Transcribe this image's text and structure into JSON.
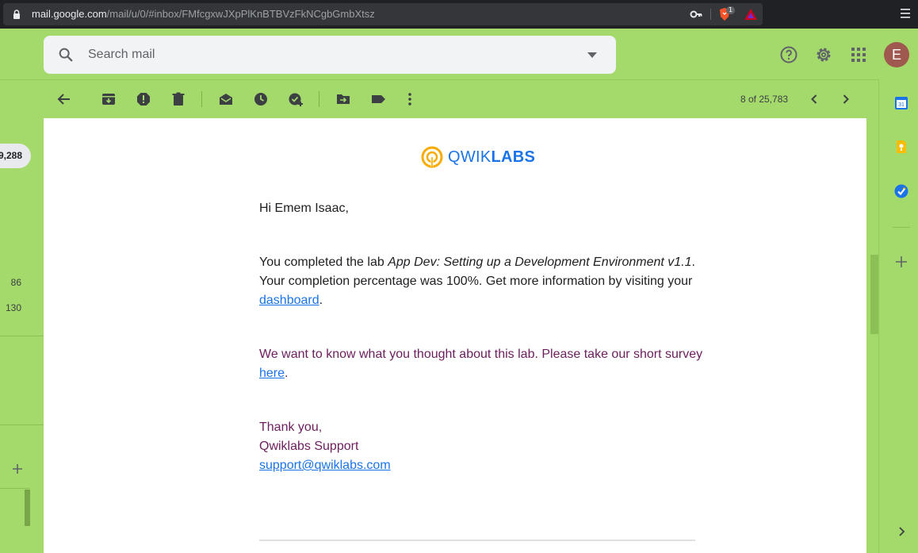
{
  "browser": {
    "url_host": "mail.google.com",
    "url_path": "/mail/u/0/#inbox/FMfcgxwJXpPlKnBTBVzFkNCgbGmbXtsz",
    "brave_badge": "1"
  },
  "header": {
    "search_placeholder": "Search mail",
    "avatar_initial": "E"
  },
  "toolbar": {
    "pager": "8 of 25,783"
  },
  "sidebar": {
    "count_pill": "9,288",
    "counts": [
      "86",
      "130"
    ]
  },
  "email": {
    "logo": {
      "part1": "QWIK",
      "part2": "LABS"
    },
    "greeting": "Hi Emem Isaac,",
    "p1_prefix": "You completed the lab ",
    "p1_lab": "App Dev: Setting up a Development Environment v1.1",
    "p1_middle": ". Your completion percentage was 100%. Get more information by visiting your ",
    "p1_link": "dashboard",
    "p1_suffix": ".",
    "p2_prefix": "We want to know what you thought about this lab. Please take our short survey ",
    "p2_link": "here",
    "p2_suffix": ".",
    "sign_thanks": "Thank you,",
    "sign_name": "Qwiklabs Support",
    "sign_email": "support@qwiklabs.com"
  },
  "side_panel": {
    "calendar_day": "31"
  },
  "colors": {
    "theme_green": "#a4d96c",
    "link_blue": "#1a73e8",
    "purple_text": "#6b1f5c",
    "avatar": "#a0594e"
  }
}
